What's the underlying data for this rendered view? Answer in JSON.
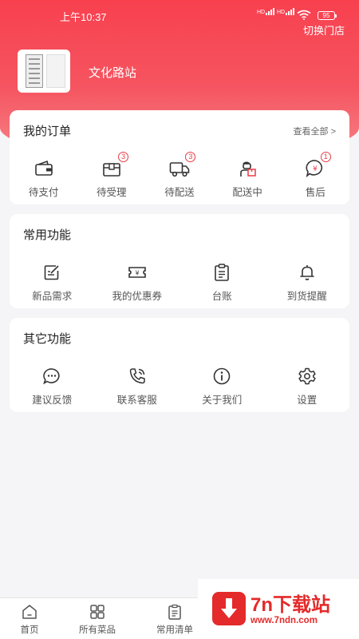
{
  "status_bar": {
    "time": "上午10:37",
    "signal_1": "HD",
    "signal_2": "HD",
    "battery": "95"
  },
  "header": {
    "switch_store": "切换门店",
    "store_name": "文化路站"
  },
  "orders": {
    "title": "我的订单",
    "view_all": "查看全部 >",
    "items": [
      {
        "label": "待支付",
        "icon": "wallet-icon",
        "badge": ""
      },
      {
        "label": "待受理",
        "icon": "gift-box-icon",
        "badge": "3"
      },
      {
        "label": "待配送",
        "icon": "truck-icon",
        "badge": "3"
      },
      {
        "label": "配送中",
        "icon": "courier-icon",
        "badge": ""
      },
      {
        "label": "售后",
        "icon": "yuan-bubble-icon",
        "badge": "1"
      }
    ]
  },
  "common": {
    "title": "常用功能",
    "items": [
      {
        "label": "新品需求",
        "icon": "edit-icon"
      },
      {
        "label": "我的优惠券",
        "icon": "coupon-icon"
      },
      {
        "label": "台账",
        "icon": "clipboard-icon"
      },
      {
        "label": "到货提醒",
        "icon": "bell-icon"
      }
    ]
  },
  "other": {
    "title": "其它功能",
    "items": [
      {
        "label": "建议反馈",
        "icon": "chat-icon"
      },
      {
        "label": "联系客服",
        "icon": "phone-icon"
      },
      {
        "label": "关于我们",
        "icon": "info-icon"
      },
      {
        "label": "设置",
        "icon": "gear-icon"
      }
    ]
  },
  "tabbar": {
    "items": [
      {
        "label": "首页",
        "icon": "home-icon"
      },
      {
        "label": "所有菜品",
        "icon": "grid-icon"
      },
      {
        "label": "常用清单",
        "icon": "list-icon"
      }
    ]
  },
  "watermark": {
    "name": "7n下载站",
    "url": "www.7ndn.com"
  },
  "colors": {
    "brand_red": "#f8404f",
    "badge_red": "#e83b47",
    "watermark_red": "#e42a2a"
  }
}
